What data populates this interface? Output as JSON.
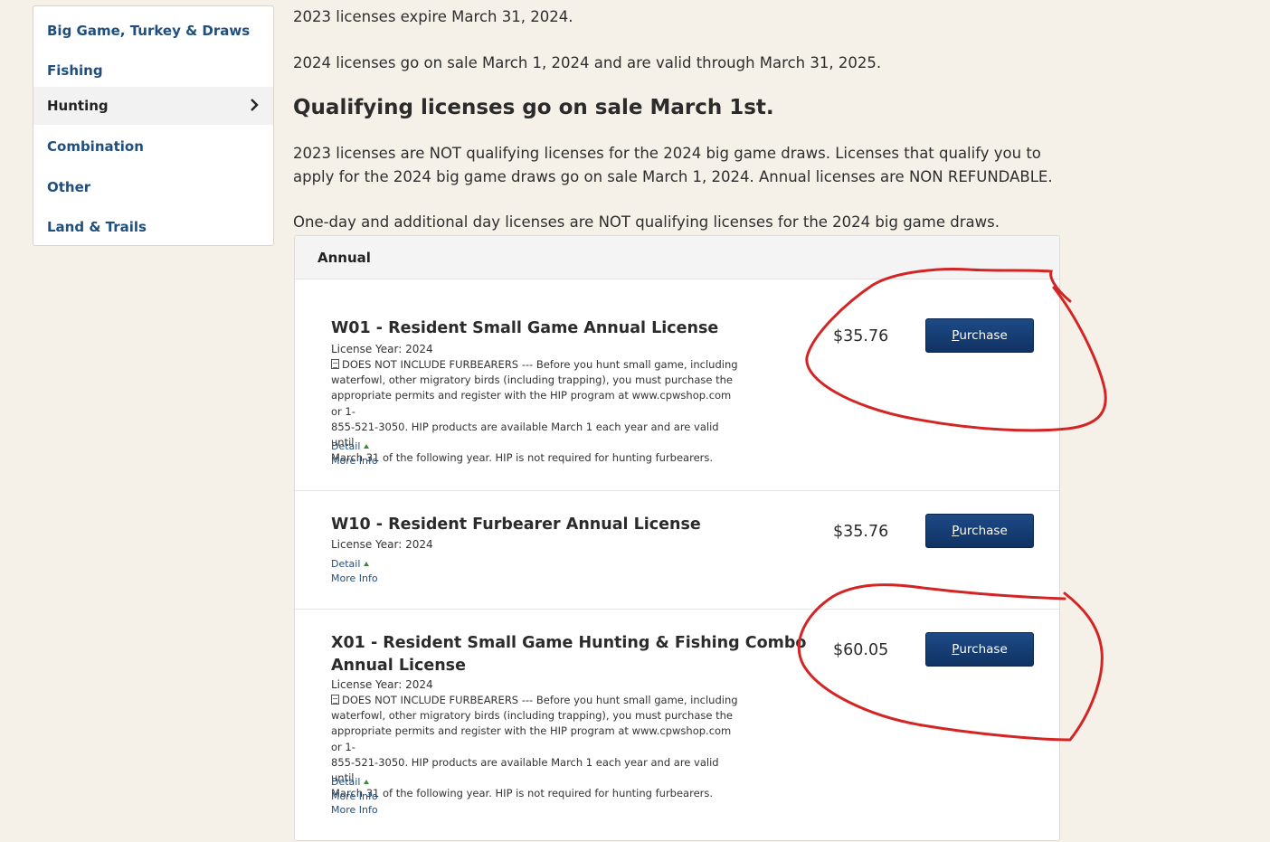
{
  "sidebar": {
    "items": [
      {
        "label": "Big Game, Turkey & Draws",
        "active": false
      },
      {
        "label": "Fishing",
        "active": false
      },
      {
        "label": "Hunting",
        "active": true
      },
      {
        "label": "Combination",
        "active": false
      },
      {
        "label": "Other",
        "active": false
      },
      {
        "label": "Land & Trails",
        "active": false
      }
    ]
  },
  "notice": {
    "line1": "2023 licenses expire March 31, 2024.",
    "line2": "2024 licenses go on sale March 1, 2024 and are valid through March 31, 2025.",
    "heading": "Qualifying licenses go on sale March 1st.",
    "para_line1": "2023 licenses are NOT qualifying licenses for the 2024 big game draws. Licenses that qualify you to",
    "para_line2": "apply for the 2024 big game draws go on sale March 1, 2024. Annual licenses are NON REFUNDABLE.",
    "line3": "One-day and additional day licenses are NOT qualifying licenses for the 2024 big game draws."
  },
  "panel": {
    "title": "Annual",
    "licenses": [
      {
        "title": "W01 - Resident Small Game Annual License",
        "year": "License Year: 2024",
        "desc_lines": [
          "DOES NOT INCLUDE FURBEARERS --- Before you hunt small game, including",
          "waterfowl, other migratory birds (including trapping), you must purchase the",
          "appropriate permits and register with the HIP program at www.cpwshop.com or 1-",
          "855-521-3050. HIP products are available March 1 each year and are valid until",
          "March 31 of the following year. HIP is not required for hunting furbearers."
        ],
        "detail": "Detail",
        "more_info": [
          "More Info"
        ],
        "price": "$35.76",
        "button_first": "P",
        "button_rest": "urchase"
      },
      {
        "title": "W10 - Resident Furbearer Annual License",
        "year": "License Year: 2024",
        "desc_lines": [],
        "detail": "Detail",
        "more_info": [
          "More Info"
        ],
        "price": "$35.76",
        "button_first": "P",
        "button_rest": "urchase"
      },
      {
        "title_line1": "X01 - Resident Small Game Hunting & Fishing Combo",
        "title_line2": "Annual License",
        "year": "License Year: 2024",
        "desc_lines": [
          "DOES NOT INCLUDE FURBEARERS --- Before you hunt small game, including",
          "waterfowl, other migratory birds (including trapping), you must purchase the",
          "appropriate permits and register with the HIP program at www.cpwshop.com or 1-",
          "855-521-3050. HIP products are available March 1 each year and are valid until",
          "March 31 of the following year. HIP is not required for hunting furbearers."
        ],
        "detail": "Detail",
        "more_info": [
          "More Info",
          "More Info"
        ],
        "price": "$60.05",
        "button_first": "P",
        "button_rest": "urchase"
      }
    ]
  },
  "colors": {
    "background": "#f5f0e8",
    "link": "#1f4f7f",
    "button": "#143d73",
    "annotation": "#d42525"
  }
}
